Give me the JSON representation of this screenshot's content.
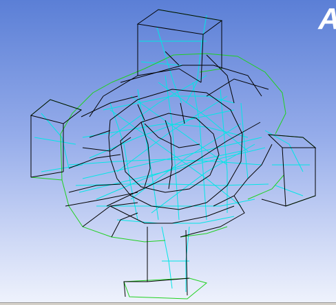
{
  "viewport": {
    "corner_text": "A",
    "background_top": "#5b7fd6",
    "background_bottom": "#eef2fc"
  },
  "mesh": {
    "edge_color_outline": "#000000",
    "edge_color_boundary": "#1fd11f",
    "edge_color_inner": "#00e6e6"
  }
}
